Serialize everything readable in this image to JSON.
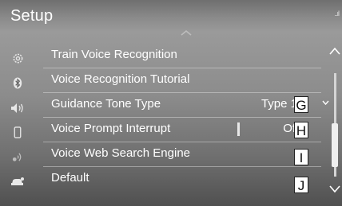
{
  "header": {
    "title": "Setup",
    "signal": "..ıl"
  },
  "sidebar": {
    "icons": [
      "gear-icon",
      "bluetooth-icon",
      "speaker-icon",
      "phone-icon",
      "voice-icon",
      "car-icon"
    ]
  },
  "menu": {
    "items": [
      {
        "label": "Train Voice Recognition",
        "value": ""
      },
      {
        "label": "Voice Recognition Tutorial",
        "value": ""
      },
      {
        "label": "Guidance Tone Type",
        "value": "Type 1"
      },
      {
        "label": "Voice Prompt Interrupt",
        "value": "Off"
      },
      {
        "label": "Voice Web Search Engine",
        "value": ""
      },
      {
        "label": "Default",
        "value": ""
      }
    ]
  },
  "callouts": [
    "G",
    "H",
    "I",
    "J"
  ],
  "colors": {
    "background_top": "#8a8a8a",
    "background_bottom": "#505050",
    "text": "#ffffff"
  }
}
